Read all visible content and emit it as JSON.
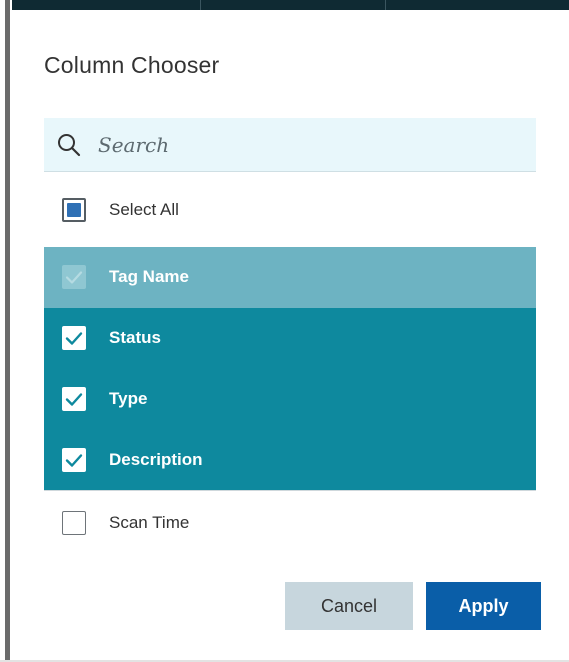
{
  "dialog": {
    "title": "Column Chooser"
  },
  "search": {
    "placeholder": "Search",
    "icon": "search-icon"
  },
  "select_all": {
    "label": "Select All",
    "state": "indeterminate"
  },
  "columns": [
    {
      "label": "Tag Name",
      "checked": true,
      "disabled": true
    },
    {
      "label": "Status",
      "checked": true,
      "disabled": false
    },
    {
      "label": "Type",
      "checked": true,
      "disabled": false
    },
    {
      "label": "Description",
      "checked": true,
      "disabled": false
    },
    {
      "label": "Scan Time",
      "checked": false,
      "disabled": false
    }
  ],
  "buttons": {
    "cancel_label": "Cancel",
    "apply_label": "Apply"
  },
  "colors": {
    "selected_row": "#0e899e",
    "disabled_row": "#6db3c2",
    "search_bg": "#e8f7fb",
    "apply_bg": "#0a5ea8",
    "cancel_bg": "#c7d6dd",
    "indeterminate_fill": "#2f70b5"
  }
}
